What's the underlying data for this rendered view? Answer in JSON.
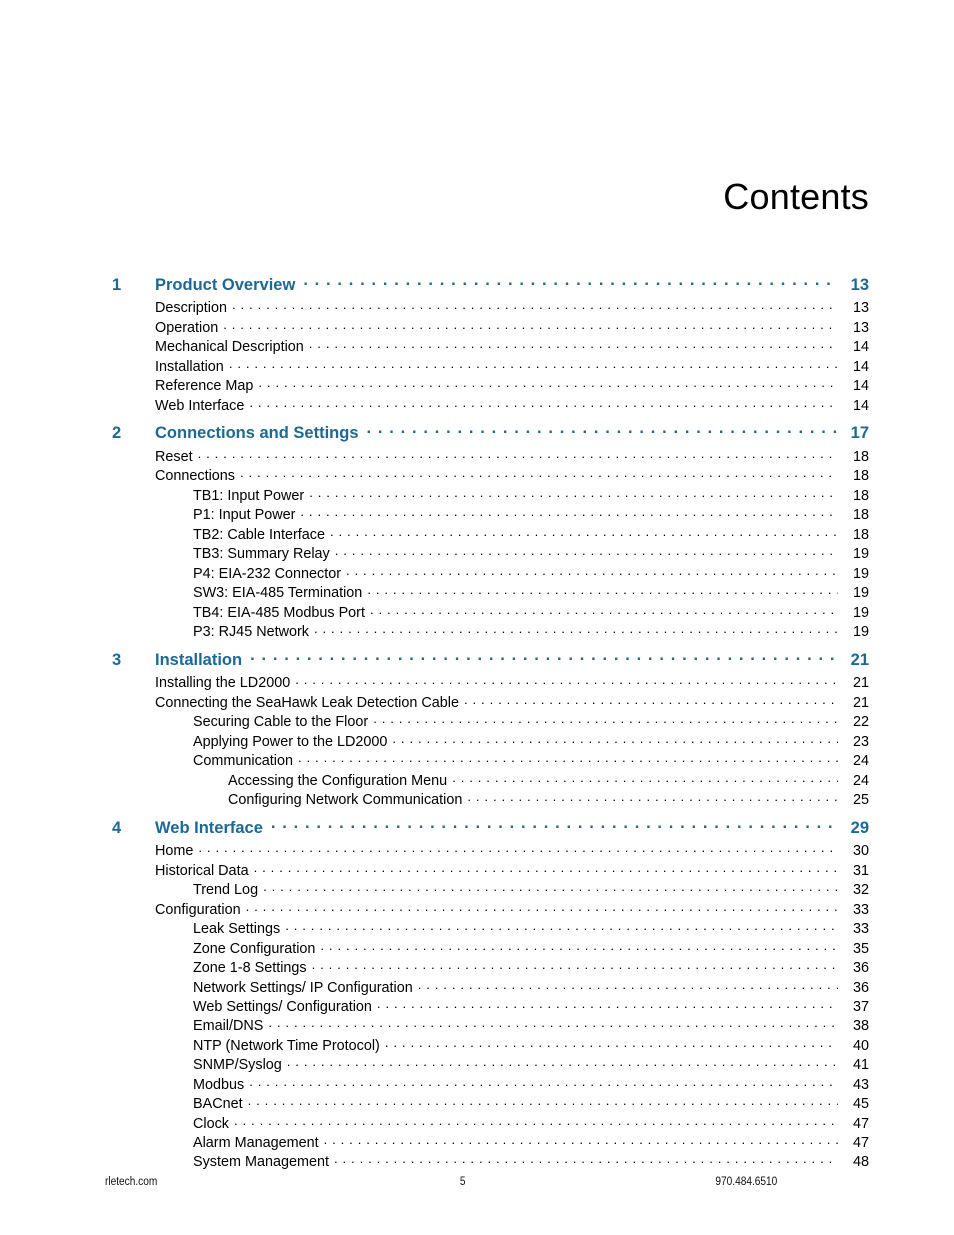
{
  "page": {
    "title": "Contents"
  },
  "toc": {
    "entries": [
      {
        "level": 0,
        "number": "1",
        "label": "Product Overview",
        "page": "13"
      },
      {
        "level": 1,
        "number": "",
        "label": "Description",
        "page": "13"
      },
      {
        "level": 1,
        "number": "",
        "label": "Operation",
        "page": "13"
      },
      {
        "level": 1,
        "number": "",
        "label": "Mechanical Description",
        "page": "14"
      },
      {
        "level": 1,
        "number": "",
        "label": "Installation",
        "page": "14"
      },
      {
        "level": 1,
        "number": "",
        "label": "Reference Map",
        "page": "14"
      },
      {
        "level": 1,
        "number": "",
        "label": "Web Interface",
        "page": "14"
      },
      {
        "level": 0,
        "number": "2",
        "label": "Connections and Settings",
        "page": "17"
      },
      {
        "level": 1,
        "number": "",
        "label": "Reset",
        "page": "18"
      },
      {
        "level": 1,
        "number": "",
        "label": "Connections",
        "page": "18"
      },
      {
        "level": 2,
        "number": "",
        "label": "TB1: Input Power",
        "page": "18"
      },
      {
        "level": 2,
        "number": "",
        "label": "P1: Input Power",
        "page": "18"
      },
      {
        "level": 2,
        "number": "",
        "label": "TB2: Cable Interface",
        "page": "18"
      },
      {
        "level": 2,
        "number": "",
        "label": "TB3: Summary Relay",
        "page": "19"
      },
      {
        "level": 2,
        "number": "",
        "label": "P4: EIA-232 Connector",
        "page": "19"
      },
      {
        "level": 2,
        "number": "",
        "label": "SW3: EIA-485 Termination",
        "page": "19"
      },
      {
        "level": 2,
        "number": "",
        "label": "TB4: EIA-485 Modbus Port",
        "page": "19"
      },
      {
        "level": 2,
        "number": "",
        "label": "P3: RJ45 Network",
        "page": "19"
      },
      {
        "level": 0,
        "number": "3",
        "label": "Installation",
        "page": "21"
      },
      {
        "level": 1,
        "number": "",
        "label": "Installing the LD2000",
        "page": "21"
      },
      {
        "level": 1,
        "number": "",
        "label": "Connecting the SeaHawk Leak Detection Cable",
        "page": "21"
      },
      {
        "level": 2,
        "number": "",
        "label": "Securing Cable to the Floor",
        "page": "22"
      },
      {
        "level": 2,
        "number": "",
        "label": "Applying Power to the LD2000",
        "page": "23"
      },
      {
        "level": 2,
        "number": "",
        "label": "Communication",
        "page": "24"
      },
      {
        "level": 3,
        "number": "",
        "label": "Accessing the Configuration Menu",
        "page": "24"
      },
      {
        "level": 3,
        "number": "",
        "label": "Configuring Network Communication",
        "page": "25"
      },
      {
        "level": 0,
        "number": "4",
        "label": "Web Interface",
        "page": "29"
      },
      {
        "level": 1,
        "number": "",
        "label": "Home",
        "page": "30"
      },
      {
        "level": 1,
        "number": "",
        "label": "Historical Data",
        "page": "31"
      },
      {
        "level": 2,
        "number": "",
        "label": "Trend Log",
        "page": "32"
      },
      {
        "level": 1,
        "number": "",
        "label": "Configuration",
        "page": "33"
      },
      {
        "level": 2,
        "number": "",
        "label": "Leak Settings",
        "page": "33"
      },
      {
        "level": 2,
        "number": "",
        "label": "Zone Configuration",
        "page": "35"
      },
      {
        "level": 2,
        "number": "",
        "label": "Zone 1-8 Settings",
        "page": "36"
      },
      {
        "level": 2,
        "number": "",
        "label": "Network Settings/ IP Configuration",
        "page": "36"
      },
      {
        "level": 2,
        "number": "",
        "label": "Web Settings/ Configuration",
        "page": "37"
      },
      {
        "level": 2,
        "number": "",
        "label": "Email/DNS",
        "page": "38"
      },
      {
        "level": 2,
        "number": "",
        "label": "NTP (Network Time Protocol)",
        "page": "40"
      },
      {
        "level": 2,
        "number": "",
        "label": "SNMP/Syslog",
        "page": "41"
      },
      {
        "level": 2,
        "number": "",
        "label": "Modbus",
        "page": "43"
      },
      {
        "level": 2,
        "number": "",
        "label": "BACnet",
        "page": "45"
      },
      {
        "level": 2,
        "number": "",
        "label": "Clock",
        "page": "47"
      },
      {
        "level": 2,
        "number": "",
        "label": "Alarm Management",
        "page": "47"
      },
      {
        "level": 2,
        "number": "",
        "label": "System Management",
        "page": "48"
      }
    ]
  },
  "footer": {
    "website": "rletech.com",
    "page_number": "5",
    "phone": "970.484.6510"
  },
  "colors": {
    "heading_blue": "#19699a",
    "body_text": "#000000",
    "background": "#ffffff"
  }
}
